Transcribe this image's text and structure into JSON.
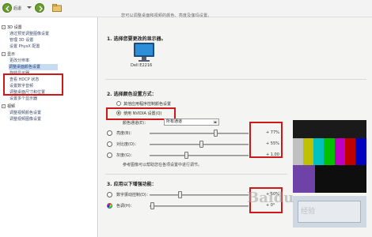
{
  "toolbar": {
    "back_label": "后退"
  },
  "tree": {
    "items": [
      {
        "label": "3D 设置",
        "type": "category"
      },
      {
        "label": "通过预览调整图像设置",
        "type": "item"
      },
      {
        "label": "管理 3D 设置",
        "type": "item"
      },
      {
        "label": "设置 PhysX 配置",
        "type": "item"
      },
      {
        "label": "显示",
        "type": "category"
      },
      {
        "label": "更改分辨率",
        "type": "item"
      },
      {
        "label": "调整桌面颜色设置",
        "type": "item",
        "selected": true
      },
      {
        "label": "旋转显示器",
        "type": "item"
      },
      {
        "label": "查看 HDCP 状态",
        "type": "item"
      },
      {
        "label": "设置数字音频",
        "type": "item"
      },
      {
        "label": "调整桌面尺寸和位置",
        "type": "item"
      },
      {
        "label": "设置多个显示器",
        "type": "item"
      },
      {
        "label": "视频",
        "type": "category"
      },
      {
        "label": "调整视频颜色设置",
        "type": "item"
      },
      {
        "label": "调整视频图像设置",
        "type": "item"
      }
    ]
  },
  "content": {
    "top_text": "您可以调整桌面和视频的颜色、亮度及伽玛设置。",
    "section1": {
      "num": "1.",
      "title": "选择您要更改的显示器。"
    },
    "monitor_label": "Dell E2216",
    "section2": {
      "num": "2.",
      "title": "选择颜色设置方式："
    },
    "radio_other": "其他应用程序控制颜色设置",
    "radio_nvidia": "使用 NVIDIA 设置(Q)",
    "channel_label": "颜色通道(E)：",
    "channel_value": "所有通道",
    "sliders": [
      {
        "label": "亮度(B)：",
        "value": "+ 77%",
        "level": 0.66
      },
      {
        "label": "对比度(O)：",
        "value": "+ 55%",
        "level": 0.52
      },
      {
        "label": "灰度(G)：",
        "value": "+ 1.00",
        "level": 0.37
      }
    ],
    "note": "参考图像可以帮助您在各项设置中进行调节。",
    "section3": {
      "num": "3.",
      "title": "应用以下增强功能："
    },
    "sliders2": [
      {
        "label": "数字振动控制(D)：",
        "value": "+ 50%",
        "level": 0.3
      },
      {
        "label": "色调(H)：",
        "value": "+ 0°",
        "level": 0.02
      }
    ]
  },
  "watermark": {
    "brand": "Baidu",
    "sub": "经验"
  },
  "colors": {
    "red_highlight": "#d01818",
    "tree_selected": "#c8dbf2",
    "monitor_blue": "#2e8fd8"
  }
}
